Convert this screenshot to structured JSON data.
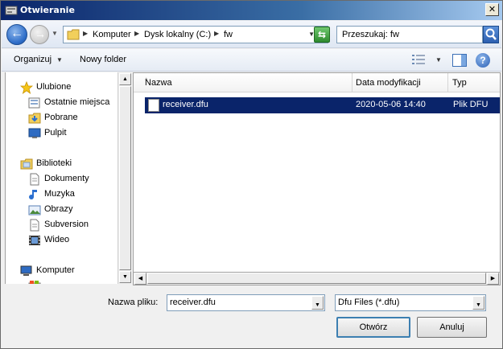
{
  "window": {
    "title": "Otwieranie",
    "close_glyph": "✕"
  },
  "nav": {
    "back_glyph": "←",
    "forward_glyph": "→",
    "dropdown_glyph": "▼",
    "breadcrumbs": [
      "Komputer",
      "Dysk lokalny (C:)",
      "fw"
    ],
    "refresh_glyph": "⇆",
    "search_placeholder": "Przeszukaj: fw"
  },
  "toolbar": {
    "organize_label": "Organizuj",
    "new_folder_label": "Nowy folder",
    "help_glyph": "?",
    "dropdown_glyph": "▼"
  },
  "sidebar": {
    "items": [
      {
        "label": "Ulubione",
        "icon": "star-icon"
      },
      {
        "label": "Ostatnie miejsca",
        "icon": "recent-places-icon"
      },
      {
        "label": "Pobrane",
        "icon": "downloads-icon"
      },
      {
        "label": "Pulpit",
        "icon": "desktop-icon"
      },
      {
        "label": "Biblioteki",
        "icon": "libraries-icon"
      },
      {
        "label": "Dokumenty",
        "icon": "documents-icon"
      },
      {
        "label": "Muzyka",
        "icon": "music-icon"
      },
      {
        "label": "Obrazy",
        "icon": "pictures-icon"
      },
      {
        "label": "Subversion",
        "icon": "subversion-icon"
      },
      {
        "label": "Wideo",
        "icon": "video-icon"
      },
      {
        "label": "Komputer",
        "icon": "computer-icon"
      }
    ]
  },
  "file_list": {
    "columns": [
      "Nazwa",
      "Data modyfikacji",
      "Typ"
    ],
    "sort_glyph": "^",
    "rows": [
      {
        "name": "receiver.dfu",
        "modified": "2020-05-06 14:40",
        "type": "Plik DFU",
        "selected": true
      }
    ]
  },
  "scrollbar": {
    "up_glyph": "▲",
    "down_glyph": "▼",
    "left_glyph": "◀",
    "right_glyph": "▶"
  },
  "footer": {
    "filename_label": "Nazwa pliku:",
    "filename_value": "receiver.dfu",
    "filetype_value": "Dfu Files (*.dfu)",
    "combo_glyph": "▼",
    "open_button": "Otwórz",
    "cancel_button": "Anuluj"
  },
  "colors": {
    "selection": "#0a246a",
    "title_bar": "#0a246a"
  }
}
